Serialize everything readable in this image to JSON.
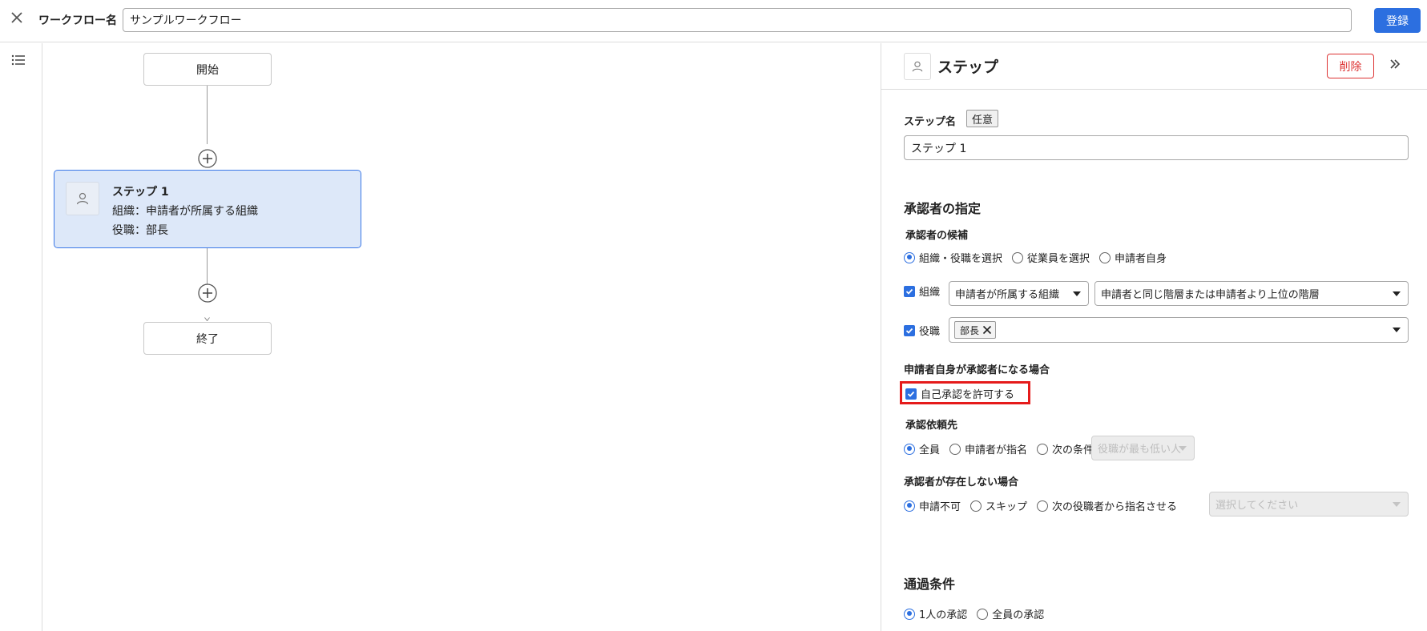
{
  "header": {
    "workflow_name_label": "ワークフロー名",
    "workflow_name_value": "サンプルワークフロー",
    "register_label": "登録"
  },
  "flow": {
    "start_label": "開始",
    "end_label": "終了",
    "step": {
      "title": "ステップ 1",
      "line1": "組織：申請者が所属する組織",
      "line2": "役職：部長"
    }
  },
  "panel": {
    "title": "ステップ",
    "delete_label": "削除",
    "step_name_label": "ステップ名",
    "optional_badge": "任意",
    "step_name_value": "ステップ 1",
    "approver_section": "承認者の指定",
    "candidates_label": "承認者の候補",
    "candidate_options": [
      "組織・役職を選択",
      "従業員を選択",
      "申請者自身"
    ],
    "candidate_selected": 0,
    "org_checkbox_label": "組織",
    "org_select_value": "申請者が所属する組織",
    "org_scope_value": "申請者と同じ階層または申請者より上位の階層",
    "position_checkbox_label": "役職",
    "position_chip": "部長",
    "self_section_label": "申請者自身が承認者になる場合",
    "self_approve_label": "自己承認を許可する",
    "request_to_label": "承認依頼先",
    "request_to_options": [
      "全員",
      "申請者が指名",
      "次の条件"
    ],
    "request_to_selected": 0,
    "request_to_condition_value": "役職が最も低い人",
    "no_approver_label": "承認者が存在しない場合",
    "no_approver_options": [
      "申請不可",
      "スキップ",
      "次の役職者から指名させる"
    ],
    "no_approver_selected": 0,
    "no_approver_select_placeholder": "選択してください",
    "pass_condition_section": "通過条件",
    "pass_condition_options": [
      "1人の承認",
      "全員の承認"
    ],
    "pass_condition_selected": 0
  },
  "colors": {
    "accent": "#2c6fe0",
    "danger": "#d33333",
    "highlight": "#e51b1b",
    "step_fill": "#dde8f9"
  }
}
